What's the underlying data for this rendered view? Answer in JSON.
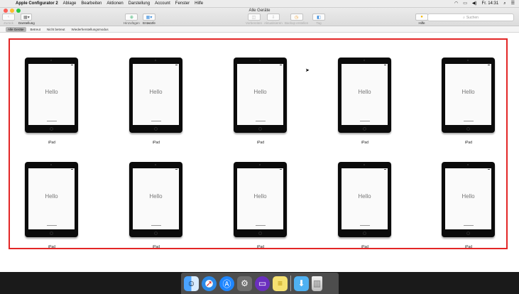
{
  "menubar": {
    "apple": "",
    "app_name": "Apple Configurator 2",
    "items": [
      "Ablage",
      "Bearbeiten",
      "Aktionen",
      "Darstellung",
      "Account",
      "Fenster",
      "Hilfe"
    ],
    "clock": "Fr. 14:31",
    "wifi_glyph": "◠",
    "display_glyph": "▭",
    "volume_glyph": "◀)",
    "search_glyph": "⌕",
    "list_glyph": "☰"
  },
  "window": {
    "title": "Alle Geräte",
    "toolbar": {
      "back": "Zurück",
      "view": "Darstellung",
      "add": "Hinzufügen",
      "blueprints": "Entwürfe",
      "prepare": "Vorbereiten",
      "update": "Aktualisieren",
      "backup": "Backup erstellen",
      "tag": "Tag",
      "help": "Hilfe",
      "search_placeholder": "Suchen"
    },
    "filters": [
      "Alle Geräte",
      "Betreut",
      "Nicht betreut",
      "Wiederherstellungsmodus"
    ]
  },
  "devices": {
    "screen_text": "Hello",
    "names": [
      "iPad",
      "iPad",
      "iPad",
      "iPad",
      "iPad",
      "iPad",
      "iPad",
      "iPad",
      "iPad",
      "iPad"
    ]
  },
  "dock": [
    "finder-icon",
    "safari-icon",
    "app-store-icon",
    "system-preferences-icon",
    "apple-configurator-icon",
    "notes-icon",
    "downloads-folder-icon",
    "trash-icon"
  ]
}
